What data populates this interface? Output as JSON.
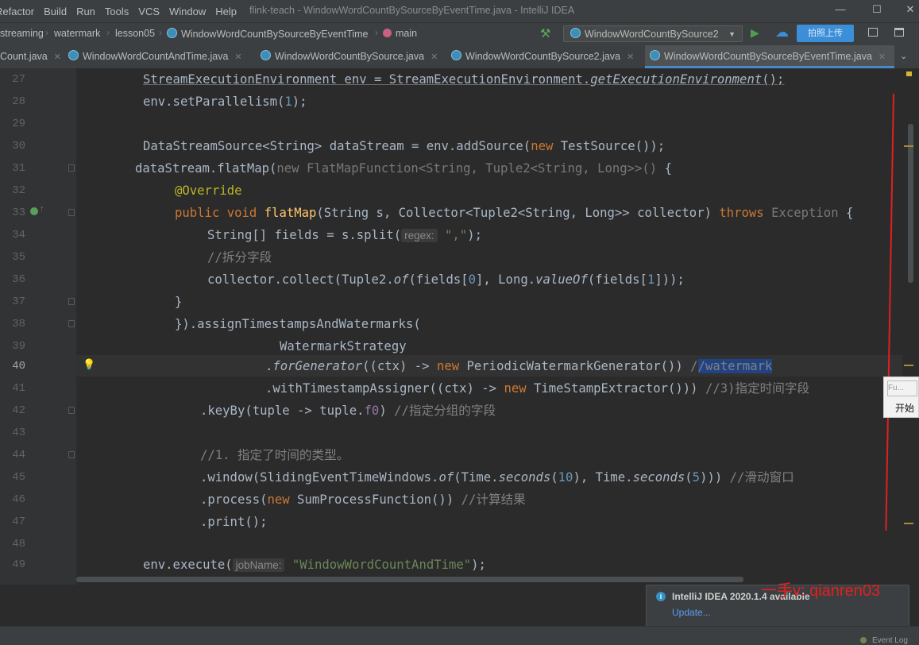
{
  "menu": [
    "Refactor",
    "Build",
    "Run",
    "Tools",
    "VCS",
    "Window",
    "Help"
  ],
  "window_title": "flink-teach - WindowWordCountBySourceByEventTime.java - IntelliJ IDEA",
  "window_controls": {
    "minimize": "—",
    "maximize": "☐",
    "close": "✕"
  },
  "breadcrumbs": [
    "streaming",
    "watermark",
    "lesson05",
    "WindowWordCountBySourceByEventTime",
    "main"
  ],
  "run_config": "WindowWordCountBySource2",
  "upload_label": "拍照上传",
  "tabs": [
    {
      "label": "Count.java"
    },
    {
      "label": "WindowWordCountAndTime.java"
    },
    {
      "label": "WindowWordCountBySource.java"
    },
    {
      "label": "WindowWordCountBySource2.java"
    },
    {
      "label": "WindowWordCountBySourceByEventTime.java",
      "active": true
    }
  ],
  "code": {
    "line_numbers": [
      "27",
      "28",
      "29",
      "30",
      "31",
      "32",
      "33",
      "34",
      "35",
      "36",
      "37",
      "38",
      "39",
      "40",
      "41",
      "42",
      "43",
      "44",
      "45",
      "46",
      "47",
      "48",
      "49"
    ],
    "l27": {
      "t1": "StreamExecutionEnvironment env = StreamExecutionEnvironment.",
      "t2": "getExecutionEnvironment",
      "t3": "();"
    },
    "l28": {
      "t1": "env.setParallelism(",
      "n": "1",
      "t2": ");"
    },
    "l30": {
      "t1": "DataStreamSource<String> dataStream = env.addSource(",
      "kw": "new",
      "t2": " TestSource());"
    },
    "l31": {
      "t1": "dataStream.flatMap(",
      "g": "new FlatMapFunction<String, Tuple2<String, Long>>()",
      "t2": " {"
    },
    "l32": {
      "ann": "@Override"
    },
    "l33": {
      "kw1": "public void ",
      "fn": "flatMap",
      "t1": "(String s, Collector<Tuple2<String, Long>> collector) ",
      "kw2": "throws",
      "g": " Exception",
      "t2": " {"
    },
    "l34": {
      "t1": "String[] fields = s.split(",
      "p": "regex:",
      "s": "\",\"",
      "t2": ");"
    },
    "l35": {
      "c": "//拆分字段"
    },
    "l36": {
      "t1": "collector.collect(Tuple2.",
      "i1": "of",
      "t2": "(fields[",
      "n1": "0",
      "t3": "], Long.",
      "i2": "valueOf",
      "t4": "(fields[",
      "n2": "1",
      "t5": "]));"
    },
    "l37": {
      "t1": "}"
    },
    "l38": {
      "t1": "}).assignTimestampsAndWatermarks("
    },
    "l39": {
      "t1": "WatermarkStrategy"
    },
    "l40": {
      "t1": ".",
      "i1": "forGenerator",
      "t2": "((ctx) -> ",
      "kw": "new",
      "t3": " PeriodicWatermarkGenerator()) ",
      "c1": "/",
      "c2": "/watermark"
    },
    "l41": {
      "t1": ".withTimestampAssigner((ctx) -> ",
      "kw": "new",
      "t2": " TimeStampExtractor())) ",
      "c": "//3)指定时间字段"
    },
    "l42": {
      "t1": ".keyBy(tuple -> tuple.",
      "f": "f0",
      "t2": ") ",
      "c": "//指定分组的字段"
    },
    "l44": {
      "c": "//1. 指定了时间的类型。"
    },
    "l45": {
      "t1": ".window(SlidingEventTimeWindows.",
      "i1": "of",
      "t2": "(Time.",
      "i2": "seconds",
      "t3": "(",
      "n1": "10",
      "t4": "), Time.",
      "i3": "seconds",
      "t5": "(",
      "n2": "5",
      "t6": "))) ",
      "c": "//滑动窗口"
    },
    "l46": {
      "t1": ".process(",
      "kw": "new",
      "t2": " SumProcessFunction()) ",
      "c": "//计算结果"
    },
    "l47": {
      "t1": ".print();"
    },
    "l49": {
      "t1": "env.execute(",
      "p": "jobName:",
      "s": "\"WindowWordCountAndTime\"",
      "t2": ");"
    }
  },
  "side_popup": {
    "top": "Fu...",
    "bottom": "开始"
  },
  "notification": {
    "title": "IntelliJ IDEA 2020.1.4 available",
    "link": "Update..."
  },
  "overlay_text": "一手v: qianren03",
  "status": {
    "event_log": "Event Log"
  },
  "colors": {
    "keyword": "#cc7832",
    "function": "#ffc66d",
    "annotation": "#bbb529",
    "number": "#6897bb",
    "string": "#6a8759",
    "comment": "#808080",
    "accent": "#4a88c7"
  }
}
